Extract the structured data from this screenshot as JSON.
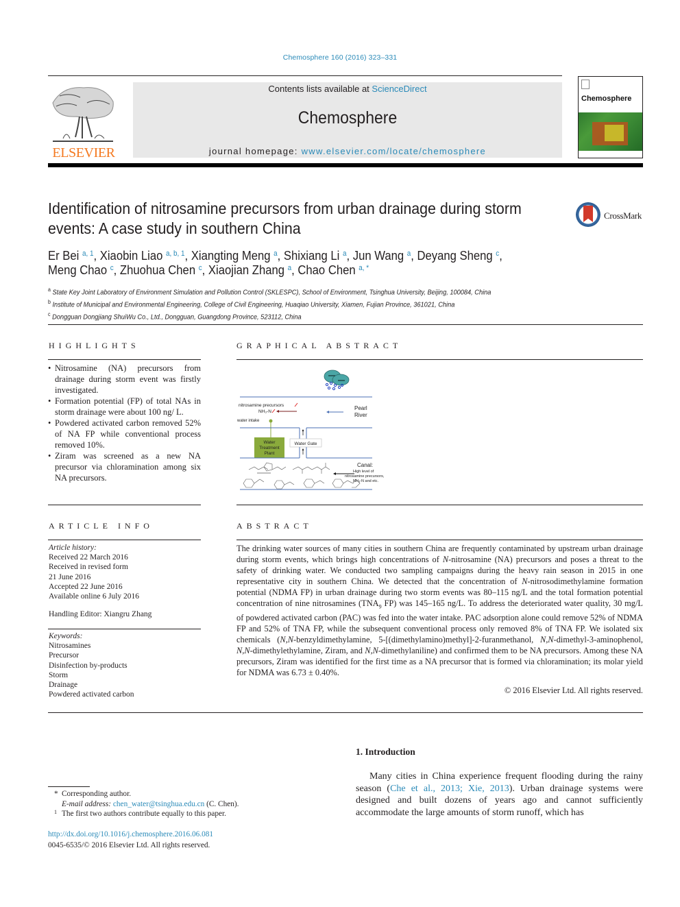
{
  "running_head": "Chemosphere 160 (2016) 323–331",
  "header": {
    "publisher_logo_text": "ELSEVIER",
    "contents_prefix": "Contents lists available at ",
    "contents_link": "ScienceDirect",
    "journal_name": "Chemosphere",
    "homepage_prefix": "journal homepage: ",
    "homepage_link": "www.elsevier.com/locate/chemosphere",
    "cover_title": "Chemosphere"
  },
  "article": {
    "title": "Identification of nitrosamine precursors from urban drainage during storm events: A case study in southern China",
    "crossmark_label": "CrossMark",
    "authors": [
      {
        "name": "Er Bei",
        "aff": "a, 1",
        "sep": ", "
      },
      {
        "name": "Xiaobin Liao",
        "aff": "a, b, 1",
        "sep": ", "
      },
      {
        "name": "Xiangting Meng",
        "aff": "a",
        "sep": ", "
      },
      {
        "name": "Shixiang Li",
        "aff": "a",
        "sep": ", "
      },
      {
        "name": "Jun Wang",
        "aff": "a",
        "sep": ", "
      },
      {
        "name": "Deyang Sheng",
        "aff": "c",
        "sep": ","
      },
      {
        "name": "Meng Chao",
        "aff": "c",
        "sep": ", "
      },
      {
        "name": "Zhuohua Chen",
        "aff": "c",
        "sep": ", "
      },
      {
        "name": "Xiaojian Zhang",
        "aff": "a",
        "sep": ", "
      },
      {
        "name": "Chao Chen",
        "aff": "a, *",
        "sep": ""
      }
    ],
    "affiliations": [
      {
        "mark": "a",
        "text": "State Key Joint Laboratory of Environment Simulation and Pollution Control (SKLESPC), School of Environment, Tsinghua University, Beijing, 100084, China"
      },
      {
        "mark": "b",
        "text": "Institute of Municipal and Environmental Engineering, College of Civil Engineering, Huaqiao University, Xiamen, Fujian Province, 361021, China"
      },
      {
        "mark": "c",
        "text": "Dongguan Dongjiang ShuiWu Co., Ltd., Dongguan, Guangdong Province, 523112, China"
      }
    ]
  },
  "highlights": {
    "heading": "HIGHLIGHTS",
    "items": [
      "Nitrosamine (NA) precursors from drainage during storm event was firstly investigated.",
      "Formation potential (FP) of total NAs in storm drainage were about 100 ng/ L.",
      "Powdered activated carbon removed 52% of NA FP while conventional process removed 10%.",
      "Ziram was screened as a new NA precursor via chloramination among six NA precursors."
    ]
  },
  "graphical_abstract": {
    "heading": "GRAPHICAL ABSTRACT",
    "labels": {
      "precursors": "nitrosamine precursors",
      "nh3n": "NH₃-N",
      "water_intake": "water intake",
      "pearl_river_1": "Pearl",
      "pearl_river_2": "River",
      "wtp_1": "Water",
      "wtp_2": "Treatment",
      "wtp_3": "Plant",
      "water_gate": "Water Gate",
      "canal": "Canal:",
      "canal_note_1": "High level of",
      "canal_note_2": "nitrosamine precursors,",
      "canal_note_3": "NH₃-N and etc."
    },
    "colors": {
      "river_line": "#4a6fb5",
      "plant_fill": "#8aaa3c",
      "arrow_dark": "#7a1e1e",
      "cloud": "#4aa6a6",
      "rain": "#2040c0"
    }
  },
  "article_info": {
    "heading": "ARTICLE INFO",
    "history_label": "Article history:",
    "history": [
      "Received 22 March 2016",
      "Received in revised form",
      "21 June 2016",
      "Accepted 22 June 2016",
      "Available online 6 July 2016"
    ],
    "handling_editor": "Handling Editor: Xiangru Zhang",
    "keywords_label": "Keywords:",
    "keywords": [
      "Nitrosamines",
      "Precursor",
      "Disinfection by-products",
      "Storm",
      "Drainage",
      "Powdered activated carbon"
    ]
  },
  "abstract": {
    "heading": "ABSTRACT",
    "segments": [
      {
        "t": "The drinking water sources of many cities in southern China are frequently contaminated by upstream urban drainage during storm events, which brings high concentrations of "
      },
      {
        "t": "N",
        "i": true
      },
      {
        "t": "-nitrosamine (NA) precursors and poses a threat to the safety of drinking water. We conducted two sampling campaigns during the heavy rain season in 2015 in one representative city in southern China. We detected that the concentration of "
      },
      {
        "t": "N",
        "i": true
      },
      {
        "t": "-nitrosodimethylamine formation potential (NDMA FP) in urban drainage during two storm events was 80–115 ng/L and the total formation potential concentration of nine nitrosamines (TNA"
      },
      {
        "t": "9",
        "sub": true
      },
      {
        "t": " FP) was 145–165 ng/L. To address the deteriorated water quality, 30 mg/L of powdered activated carbon (PAC) was fed into the water intake. PAC adsorption alone could remove 52% of NDMA FP and 52% of TNA FP, while the subsequent conventional process only removed 8% of TNA FP. We isolated six chemicals ("
      },
      {
        "t": "N,N",
        "i": true
      },
      {
        "t": "-benzyldimethylamine, 5-[(dimethylamino)methyl]-2-furanmethanol, "
      },
      {
        "t": "N,N",
        "i": true
      },
      {
        "t": "-dimethyl-3-aminophenol, "
      },
      {
        "t": "N,N",
        "i": true
      },
      {
        "t": "-dimethylethylamine, Ziram, and "
      },
      {
        "t": "N,N",
        "i": true
      },
      {
        "t": "-dimethylaniline) and confirmed them to be NA precursors. Among these NA precursors, Ziram was identified for the first time as a NA precursor that is formed via chloramination; its molar yield for NDMA was 6.73 ± 0.40%."
      }
    ],
    "copyright": "© 2016 Elsevier Ltd. All rights reserved."
  },
  "footnotes": {
    "corresponding_mark": "*",
    "corresponding": "Corresponding author.",
    "email_label": "E-mail address: ",
    "email": "chen_water@tsinghua.edu.cn",
    "email_suffix": " (C. Chen).",
    "equal_mark": "1",
    "equal_contrib": "The first two authors contribute equally to this paper.",
    "doi": "http://dx.doi.org/10.1016/j.chemosphere.2016.06.081",
    "issn_copyright": "0045-6535/© 2016 Elsevier Ltd. All rights reserved."
  },
  "introduction": {
    "heading": "1.  Introduction",
    "text_before": "Many cities in China experience frequent flooding during the rainy season (",
    "citation": "Che et al., 2013; Xie, 2013",
    "text_after": "). Urban drainage systems were designed and built dozens of years ago and cannot sufficiently accommodate the large amounts of storm runoff, which has"
  },
  "colors": {
    "link": "#2a8ab8",
    "elsevier_orange": "#f47920",
    "banner_bg": "#e8e8e8",
    "crossmark_red": "#d23a2b",
    "crossmark_blue": "#3e6fa8"
  }
}
